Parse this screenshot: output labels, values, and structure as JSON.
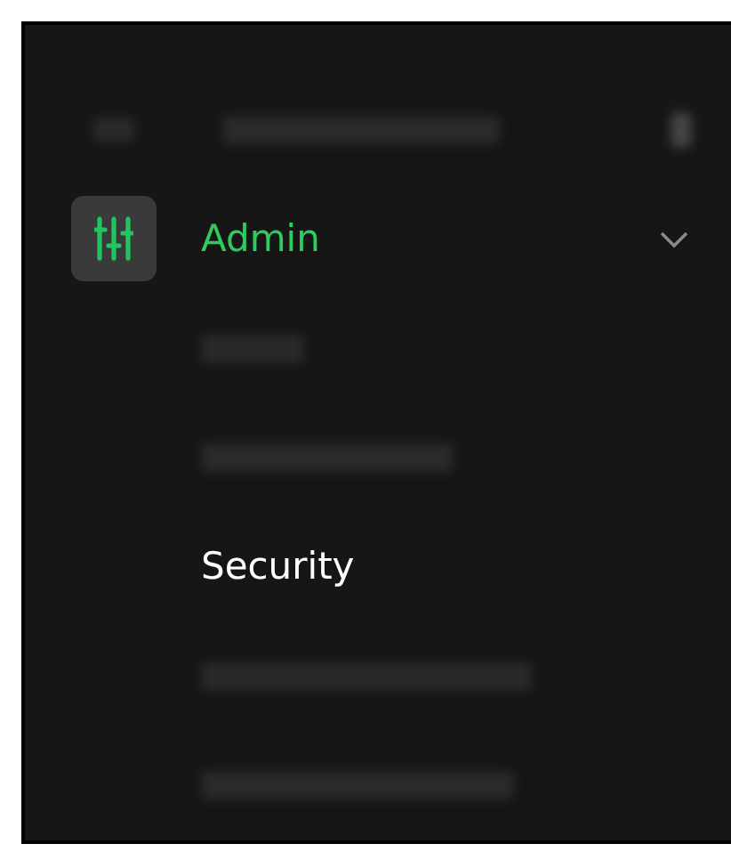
{
  "sidebar": {
    "items": [
      {
        "kind": "redacted",
        "selected": false
      },
      {
        "kind": "menu",
        "label": "Admin",
        "selected": true,
        "expanded": true,
        "children": [
          {
            "kind": "redacted",
            "selected": false
          },
          {
            "kind": "redacted",
            "selected": false
          },
          {
            "kind": "link",
            "label": "Security",
            "selected": true
          },
          {
            "kind": "redacted",
            "selected": false
          },
          {
            "kind": "redacted",
            "selected": false
          }
        ]
      }
    ]
  }
}
